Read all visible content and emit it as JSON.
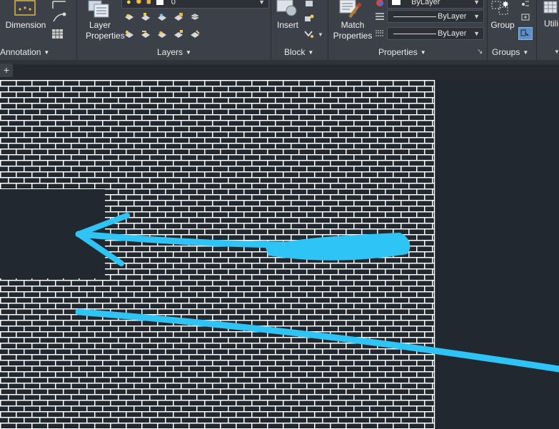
{
  "ribbon": {
    "annotation": {
      "dimension_label": "Dimension",
      "panel_title": "Annotation"
    },
    "layers": {
      "layer_properties_label": "Layer Properties",
      "current_layer_value": "0",
      "panel_title": "Layers"
    },
    "block": {
      "insert_label": "Insert",
      "panel_title": "Block"
    },
    "properties": {
      "match_properties_label": "Match Properties",
      "color_value": "ByLayer",
      "linetype_value": "ByLayer",
      "lineweight_value": "ByLayer",
      "panel_title": "Properties"
    },
    "groups": {
      "group_label": "Group",
      "panel_title": "Groups"
    },
    "utilities": {
      "label": "Utili"
    }
  },
  "tabs": {
    "new_tab_symbol": "+"
  },
  "drawing": {
    "hatch_pattern": "brick",
    "hatch_color": "#ffffff",
    "background_color": "#212830",
    "annotation_arrow_color": "#2ec4f5"
  }
}
